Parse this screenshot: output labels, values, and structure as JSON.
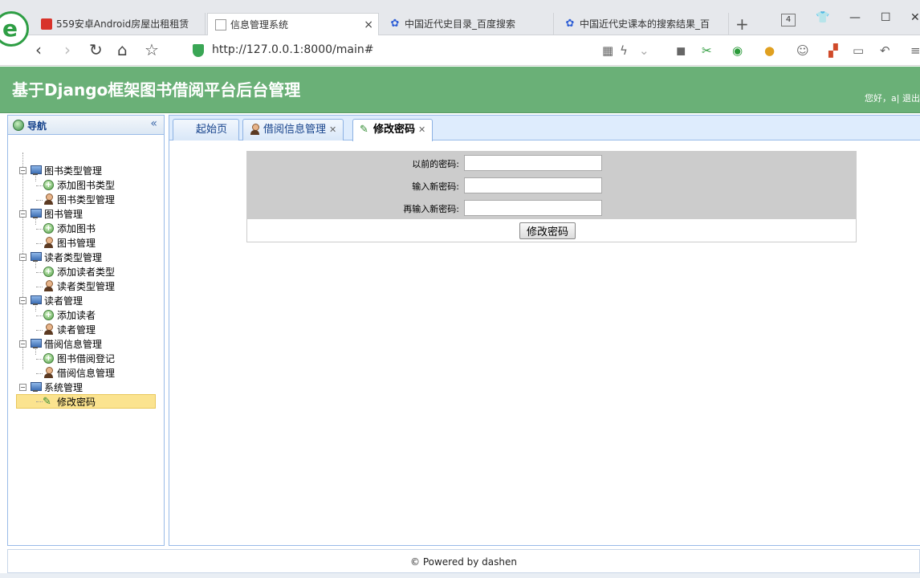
{
  "browser": {
    "tabs": [
      {
        "title": "559安卓Android房屋出租租赁",
        "active": false
      },
      {
        "title": "信息管理系统",
        "active": true
      },
      {
        "title": "中国近代史目录_百度搜索",
        "active": false
      },
      {
        "title": "中国近代史课本的搜索结果_百",
        "active": false
      }
    ],
    "tab_count": "4",
    "url": "http://127.0.0.1:8000/main#"
  },
  "header": {
    "title": "基于Django框架图书借阅平台后台管理",
    "user_text": "您好，a| 退出"
  },
  "sidebar": {
    "title": "导航",
    "groups": [
      {
        "label": "图书类型管理",
        "items": [
          "添加图书类型",
          "图书类型管理"
        ]
      },
      {
        "label": "图书管理",
        "items": [
          "添加图书",
          "图书管理"
        ]
      },
      {
        "label": "读者类型管理",
        "items": [
          "添加读者类型",
          "读者类型管理"
        ]
      },
      {
        "label": "读者管理",
        "items": [
          "添加读者",
          "读者管理"
        ]
      },
      {
        "label": "借阅信息管理",
        "items": [
          "图书借阅登记",
          "借阅信息管理"
        ]
      },
      {
        "label": "系统管理",
        "items": [
          "修改密码"
        ]
      }
    ]
  },
  "content_tabs": {
    "home": "起始页",
    "borrow": "借阅信息管理",
    "password": "修改密码"
  },
  "form": {
    "old_label": "以前的密码:",
    "new_label": "输入新密码:",
    "confirm_label": "再输入新密码:",
    "old_value": "",
    "new_value": "",
    "confirm_value": "",
    "submit_label": "修改密码"
  },
  "footer": {
    "text": "© Powered by dashen"
  },
  "colors": {
    "header_bg": "#6ab077",
    "panel_border": "#99bbe8",
    "selected_bg": "#fbe38f"
  }
}
